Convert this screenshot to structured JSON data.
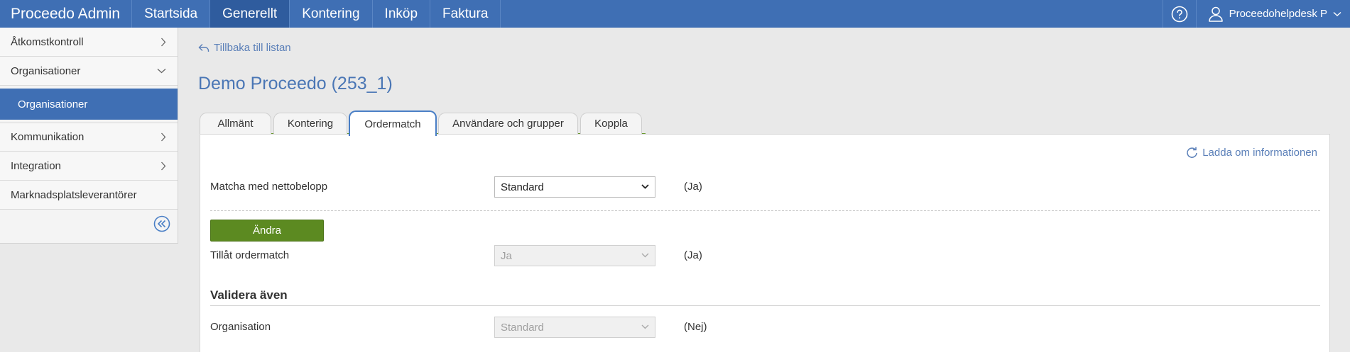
{
  "app": {
    "title": "Proceedo Admin"
  },
  "nav": {
    "items": [
      {
        "label": "Startsida"
      },
      {
        "label": "Generellt"
      },
      {
        "label": "Kontering"
      },
      {
        "label": "Inköp"
      },
      {
        "label": "Faktura"
      }
    ],
    "active": "Generellt"
  },
  "user": {
    "name": "Proceedohelpdesk P"
  },
  "sidebar": {
    "items": [
      {
        "label": "Åtkomstkontroll"
      },
      {
        "label": "Organisationer"
      },
      {
        "label": "Organisationer"
      },
      {
        "label": "Kommunikation"
      },
      {
        "label": "Integration"
      },
      {
        "label": "Marknadsplatsleverantörer"
      }
    ]
  },
  "back_link": "Tillbaka till listan",
  "page": {
    "title": "Demo Proceedo (253_1)"
  },
  "tabs": [
    {
      "label": "Allmänt"
    },
    {
      "label": "Kontering"
    },
    {
      "label": "Ordermatch"
    },
    {
      "label": "Användare och grupper"
    },
    {
      "label": "Koppla"
    }
  ],
  "active_tab": "Ordermatch",
  "reload_link": "Ladda om informationen",
  "form": {
    "net_amount": {
      "label": "Matcha med nettobelopp",
      "value": "Standard",
      "note": "(Ja)"
    },
    "change_button": "Ändra",
    "allow_ordermatch": {
      "label": "Tillåt ordermatch",
      "value": "Ja",
      "note": "(Ja)"
    },
    "validate_section": "Validera även",
    "organisation": {
      "label": "Organisation",
      "value": "Standard",
      "note": "(Nej)"
    }
  },
  "colors": {
    "brand": "#3f6fb4",
    "accent_green": "#5c8a21",
    "link": "#5a7fb8"
  }
}
